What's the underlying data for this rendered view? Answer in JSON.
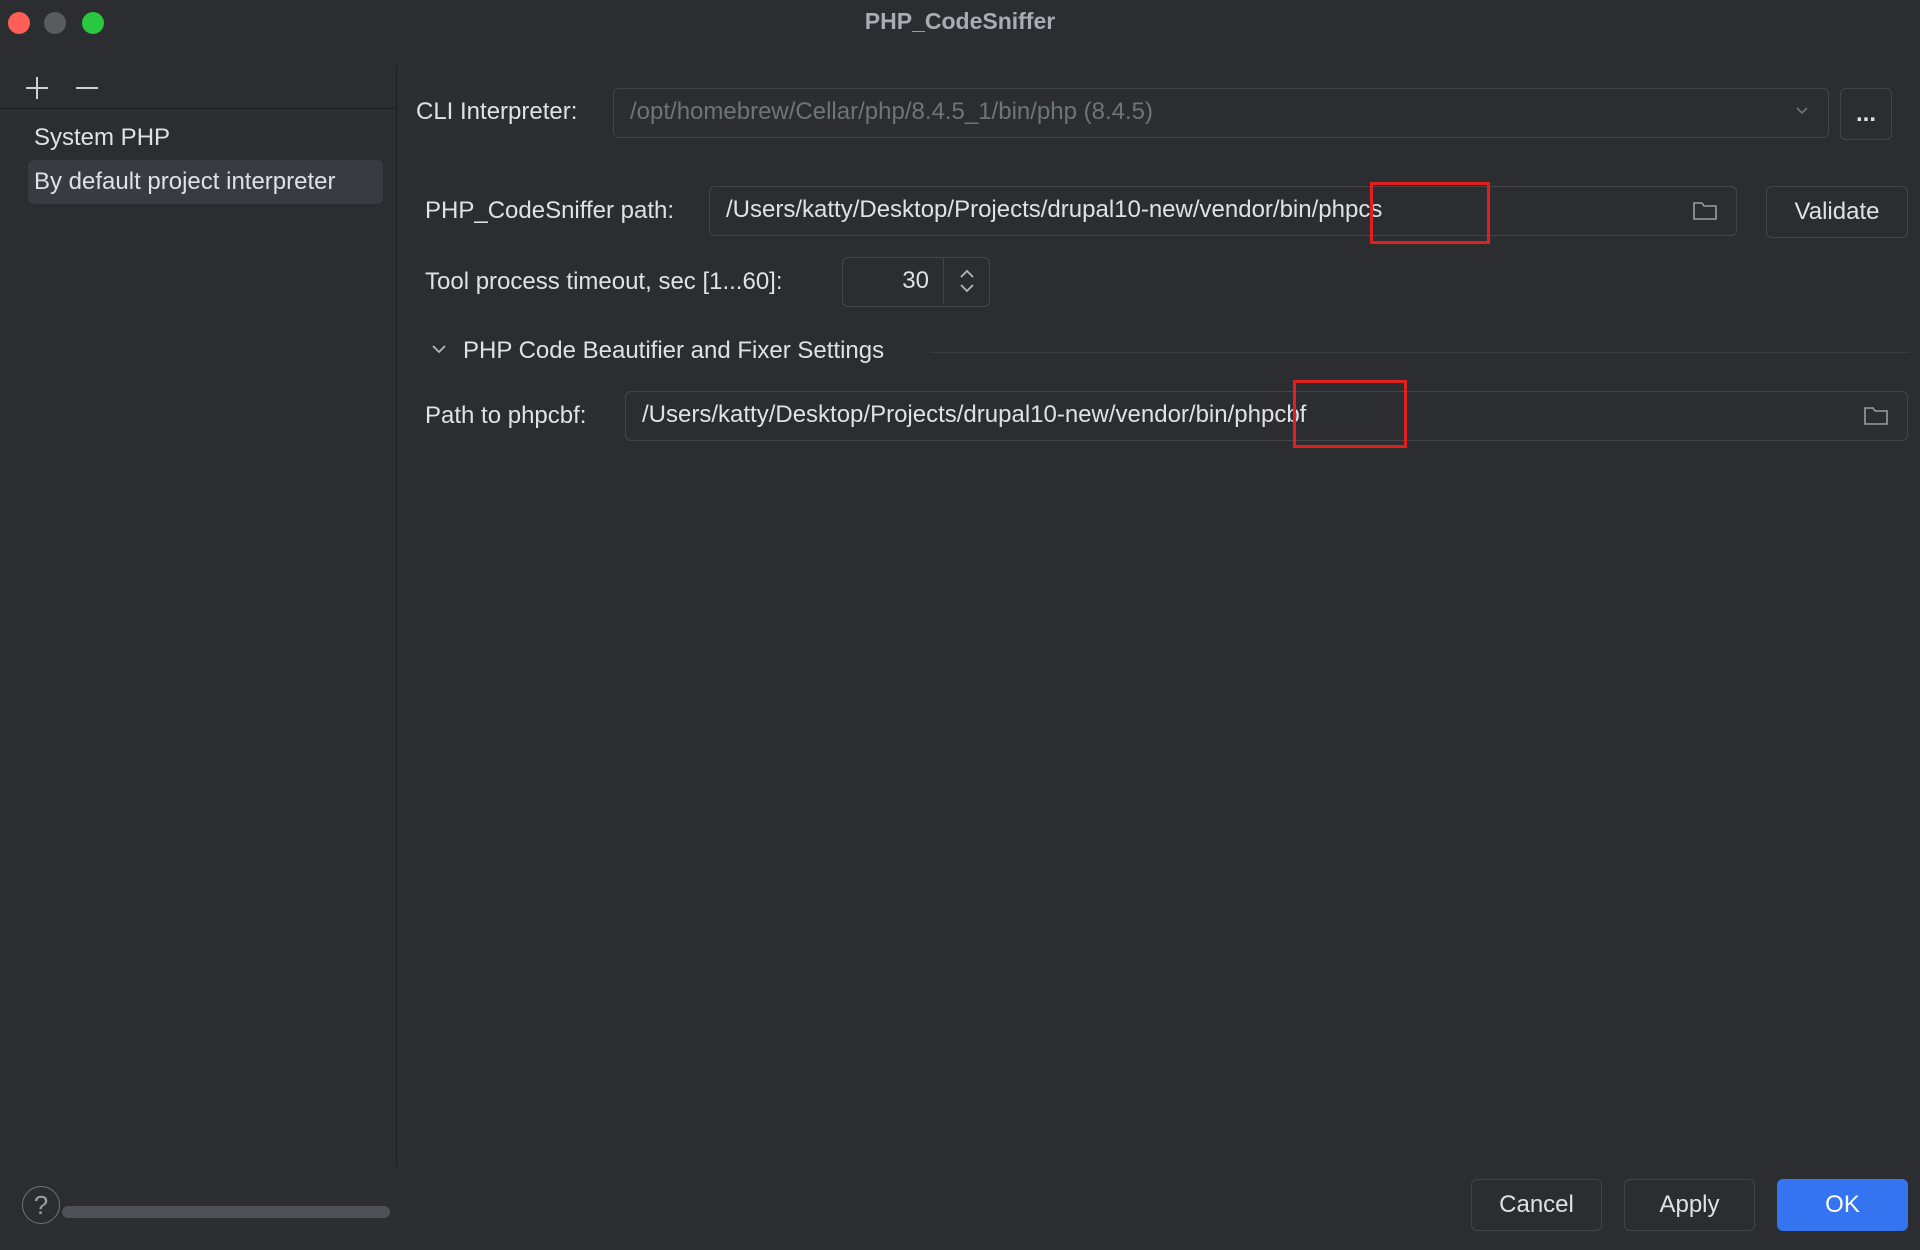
{
  "window": {
    "title": "PHP_CodeSniffer"
  },
  "sidebar": {
    "items": [
      {
        "label": "System PHP"
      },
      {
        "label": "By default project interpreter"
      }
    ]
  },
  "form": {
    "cli_interpreter": {
      "label": "CLI Interpreter:",
      "value": "/opt/homebrew/Cellar/php/8.4.5_1/bin/php (8.4.5)",
      "browse_label": "..."
    },
    "codesniffer_path": {
      "label": "PHP_CodeSniffer path:",
      "value": "/Users/katty/Desktop/Projects/drupal10-new/vendor/bin/phpcs",
      "validate_label": "Validate"
    },
    "timeout": {
      "label": "Tool process timeout, sec [1...60]:",
      "value": "30"
    },
    "beautifier_section": {
      "title": "PHP Code Beautifier and Fixer Settings",
      "path_label": "Path to phpcbf:",
      "path_value": "/Users/katty/Desktop/Projects/drupal10-new/vendor/bin/phpcbf"
    }
  },
  "footer": {
    "help_label": "?",
    "cancel_label": "Cancel",
    "apply_label": "Apply",
    "ok_label": "OK"
  },
  "colors": {
    "accent": "#3574f0",
    "highlight_box": "#e01f1f"
  }
}
